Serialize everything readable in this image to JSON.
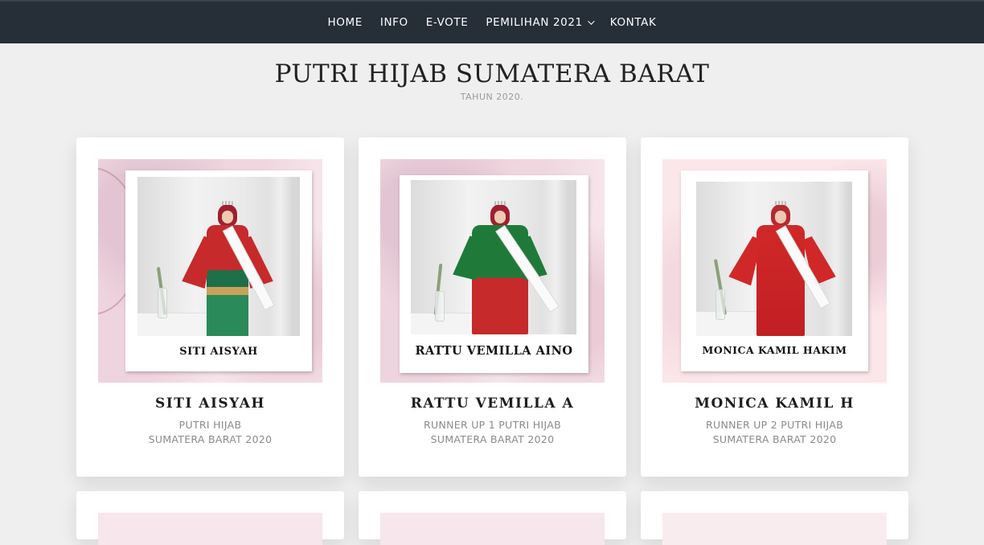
{
  "nav": {
    "items": [
      {
        "label": "HOME"
      },
      {
        "label": "INFO"
      },
      {
        "label": "E-VOTE"
      },
      {
        "label": "PEMILIHAN 2021",
        "has_dropdown": true
      },
      {
        "label": "KONTAK"
      }
    ],
    "dropdown_icon": "chevron-down-icon",
    "background": "#262e38"
  },
  "header": {
    "title": "PUTRI HIJAB SUMATERA BARAT",
    "subtitle": "TAHUN 2020."
  },
  "cards": [
    {
      "plate_name": "SITI AISYAH",
      "name": "SITI AISYAH",
      "desc_line1": "PUTRI HIJAB",
      "desc_line2": "SUMATERA BARAT 2020"
    },
    {
      "plate_name": "RATTU VEMILLA AINO",
      "name": "RATTU VEMILLA A",
      "desc_line1": "RUNNER UP 1 PUTRI HIJAB",
      "desc_line2": "SUMATERA BARAT 2020"
    },
    {
      "plate_name": "MONICA KAMIL HAKIM",
      "name": "MONICA KAMIL H",
      "desc_line1": "RUNNER UP 2 PUTRI HIJAB",
      "desc_line2": "SUMATERA BARAT 2020"
    }
  ],
  "colors": {
    "page_bg": "#efefef",
    "card_bg": "#ffffff",
    "text_muted": "#8a8a8a",
    "frame_pink": "#f6e4ea",
    "dress_red": "#c62a2a",
    "dress_green": "#1f7a3a",
    "hijab_maroon": "#9e2030"
  }
}
